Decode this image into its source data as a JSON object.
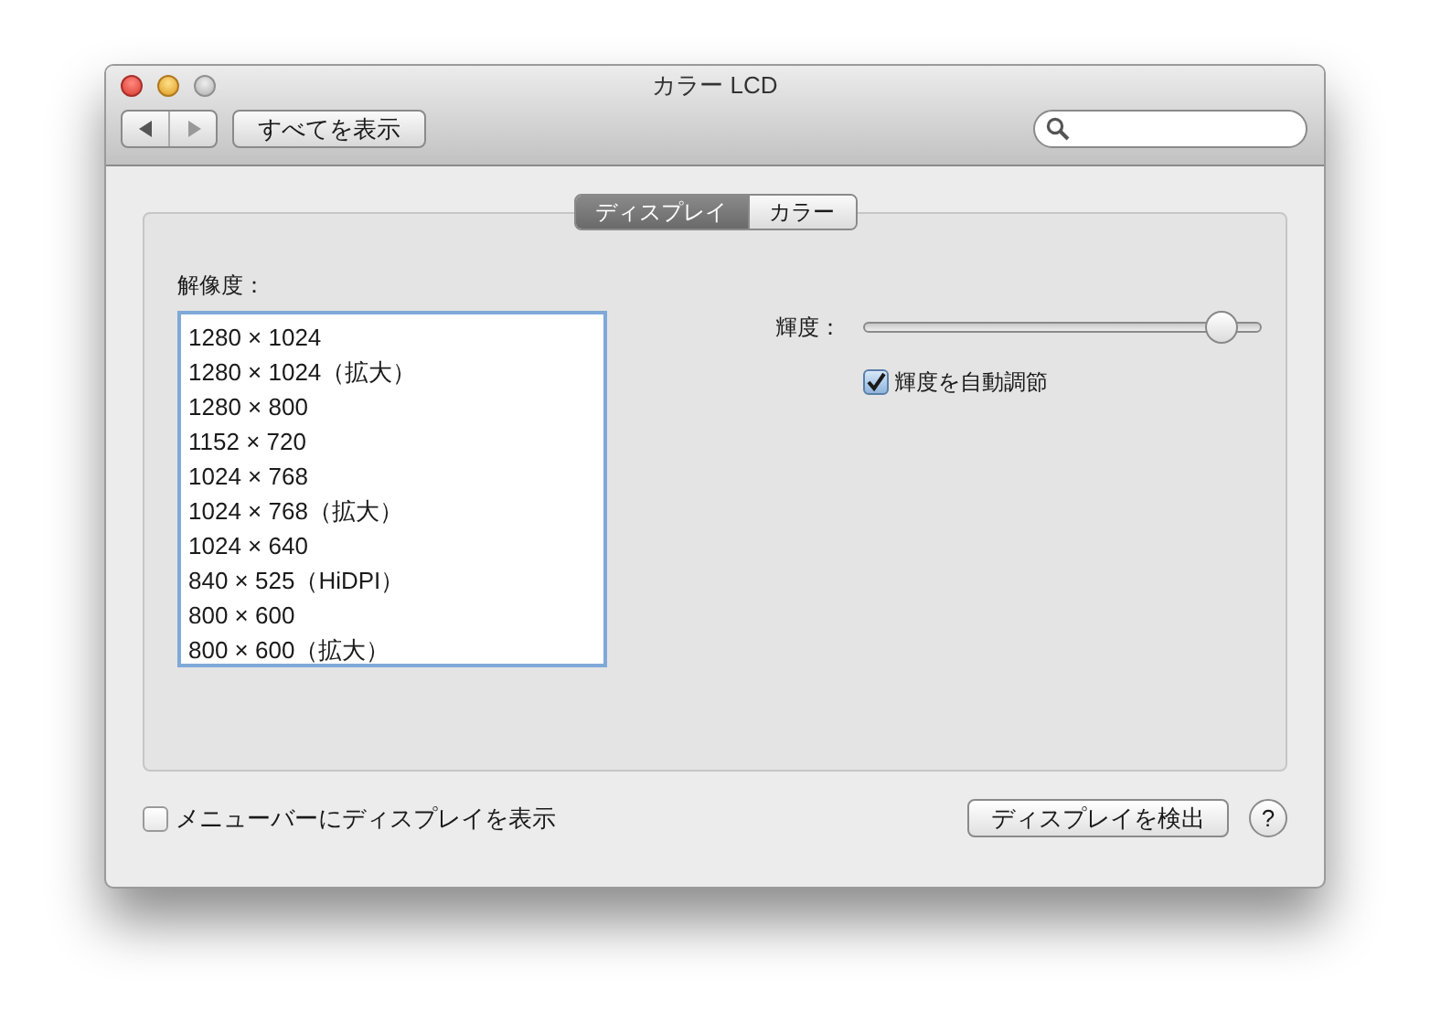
{
  "window": {
    "title": "カラー LCD"
  },
  "toolbar": {
    "show_all_button": "すべてを表示"
  },
  "tabs": [
    {
      "label": "ディスプレイ",
      "selected": true
    },
    {
      "label": "カラー",
      "selected": false
    }
  ],
  "resolution": {
    "label": "解像度：",
    "items": [
      {
        "label": "1280 × 1024",
        "selected": false
      },
      {
        "label": "1280 × 1024（拡大）",
        "selected": false
      },
      {
        "label": "1280 × 800",
        "selected": false
      },
      {
        "label": "1152 × 720",
        "selected": false
      },
      {
        "label": "1024 × 768",
        "selected": false
      },
      {
        "label": "1024 × 768（拡大）",
        "selected": false
      },
      {
        "label": "1024 × 640",
        "selected": false
      },
      {
        "label": "840 × 525（HiDPI）",
        "selected": false
      },
      {
        "label": "800 × 600",
        "selected": false
      },
      {
        "label": "800 × 600（拡大）",
        "selected": false
      }
    ]
  },
  "brightness": {
    "label": "輝度：",
    "level": 0.9,
    "auto": {
      "label": "輝度を自動調節",
      "checked": true
    }
  },
  "menubar_checkbox": {
    "label": "メニューバーにディスプレイを表示",
    "checked": false
  },
  "detect_button": "ディスプレイを検出",
  "help_button": "?"
}
